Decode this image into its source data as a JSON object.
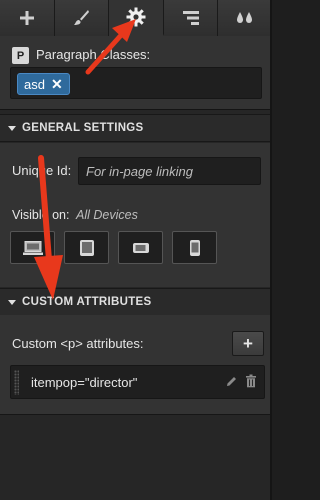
{
  "tabs": [
    {
      "icon": "plus-icon"
    },
    {
      "icon": "brush-icon"
    },
    {
      "icon": "gear-icon",
      "active": true
    },
    {
      "icon": "navigator-icon"
    },
    {
      "icon": "drops-icon"
    }
  ],
  "classes": {
    "badge": "P",
    "label": "Paragraph Classes:",
    "chips": [
      "asd"
    ],
    "chip_remove": "✕"
  },
  "general_settings": {
    "header": "GENERAL SETTINGS",
    "unique_id_label": "Unique Id:",
    "unique_id_placeholder": "For in-page linking",
    "visible_on_label": "Visible on:",
    "visible_on_value": "All Devices",
    "devices": [
      "desktop-icon",
      "tablet-icon",
      "phone-landscape-icon",
      "phone-portrait-icon"
    ]
  },
  "custom_attributes": {
    "header": "CUSTOM ATTRIBUTES",
    "label": "Custom <p> attributes:",
    "add_label": "+",
    "items": [
      "itempop=\"director\""
    ]
  },
  "colors": {
    "accent": "#2f6a9c",
    "annotation": "#e8381c",
    "panel": "#333333"
  }
}
